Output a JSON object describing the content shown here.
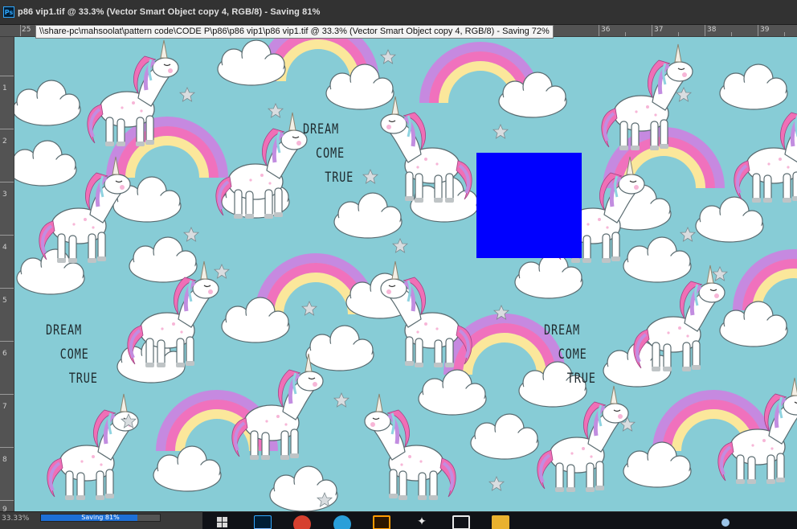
{
  "window": {
    "title": "p86 vip1.tif @ 33.3% (Vector Smart Object copy 4, RGB/8) - Saving 81%",
    "app_badge": "Ps"
  },
  "tooltip": {
    "text": "\\\\share-pc\\mahsoolat\\pattern code\\CODE P\\p86\\p86 vip1\\p86 vip1.tif @ 33.3% (Vector Smart Object copy 4, RGB/8) - Saving 72%"
  },
  "ruler_top": {
    "labels": [
      "25",
      "36",
      "37",
      "38",
      "39"
    ]
  },
  "ruler_left": {
    "labels": [
      "1",
      "2",
      "3",
      "4",
      "5",
      "6",
      "7",
      "8",
      "9"
    ]
  },
  "canvas": {
    "background": "#87ccd6",
    "overlay_color": "#0000ff",
    "dream_text": [
      {
        "line1": "DREAM",
        "line2": "COME",
        "line3": "TRUE"
      },
      {
        "line1": "DREAM",
        "line2": "COME",
        "line3": "TRUE"
      },
      {
        "line1": "DREAM",
        "line2": "COME",
        "line3": "TRUE"
      }
    ]
  },
  "status": {
    "zoom": "33.33%",
    "saving_label": "Saving 81%",
    "saving_progress": 0.81
  },
  "taskbar": {
    "icons": [
      "windows-icon",
      "photoshop-icon",
      "chrome-icon",
      "telegram-icon",
      "illustrator-icon",
      "game-icon",
      "app-window-icon",
      "folder-icon"
    ]
  }
}
